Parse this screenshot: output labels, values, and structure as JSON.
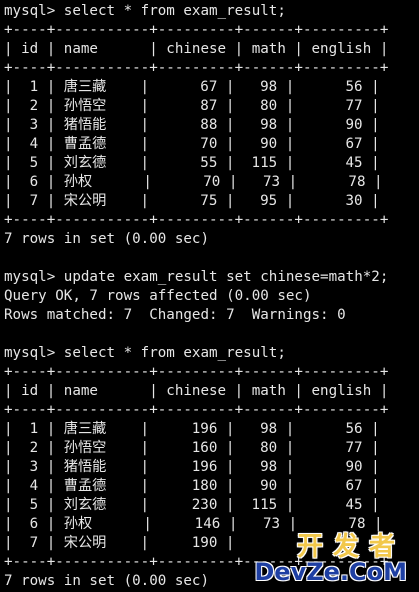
{
  "session": {
    "select1_cmd": "mysql> select * from exam_result;",
    "table1": {
      "border": "+----+-----------+---------+------+---------+",
      "header": "| id | name      | chinese | math | english |",
      "rows": [
        "|  1 | 唐三藏    |      67 |   98 |      56 |",
        "|  2 | 孙悟空    |      87 |   80 |      77 |",
        "|  3 | 猪悟能    |      88 |   98 |      90 |",
        "|  4 | 曹孟德    |      70 |   90 |      67 |",
        "|  5 | 刘玄德    |      55 |  115 |      45 |",
        "|  6 | 孙权      |      70 |   73 |      78 |",
        "|  7 | 宋公明    |      75 |   95 |      30 |"
      ]
    },
    "result1": "7 rows in set (0.00 sec)",
    "update_cmd": "mysql> update exam_result set chinese=math*2;",
    "update_ok": "Query OK, 7 rows affected (0.00 sec)",
    "update_info": "Rows matched: 7  Changed: 7  Warnings: 0",
    "select2_cmd": "mysql> select * from exam_result;",
    "table2": {
      "border": "+----+-----------+---------+------+---------+",
      "header": "| id | name      | chinese | math | english |",
      "rows": [
        "|  1 | 唐三藏    |     196 |   98 |      56 |",
        "|  2 | 孙悟空    |     160 |   80 |      77 |",
        "|  3 | 猪悟能    |     196 |   98 |      90 |",
        "|  4 | 曹孟德    |     180 |   90 |      67 |",
        "|  5 | 刘玄德    |     230 |  115 |      45 |",
        "|  6 | 孙权      |     146 |   73 |      78 |",
        "|  7 | 宋公明    |     190 |",
        ""
      ]
    },
    "result2": "7 rows in set (0.00 sec)"
  },
  "watermark": {
    "cn": "开发者",
    "en": "DevZe.CoM"
  },
  "colors": {
    "background": "#000000",
    "text": "#e6e6e6",
    "watermark_cn": "#f2c84b",
    "watermark_en": "#1e3fa3"
  }
}
